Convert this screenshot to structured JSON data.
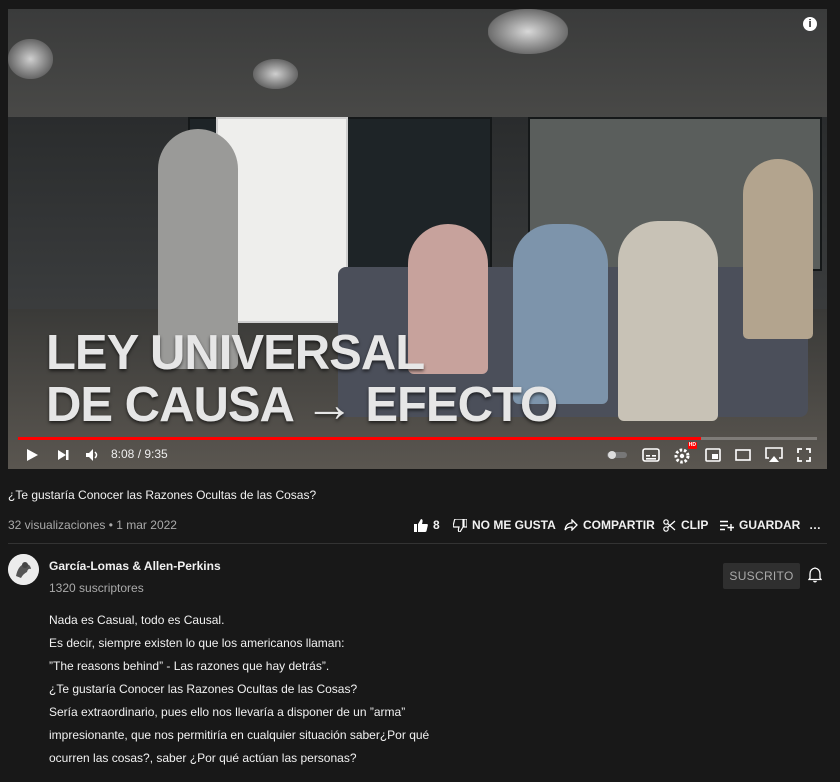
{
  "video": {
    "overlay_line1": "LEY UNIVERSAL",
    "overlay_line2": "DE CAUSA → EFECTO",
    "progress_fraction": 0.855,
    "time_display": "8:08 / 9:35"
  },
  "controls": {
    "play_icon": "play-icon",
    "next_icon": "next-icon",
    "volume_icon": "volume-icon",
    "autoplay_icon": "autoplay-toggle-icon",
    "subtitles_icon": "subtitles-icon",
    "settings_icon": "settings-icon",
    "settings_badge": "HD",
    "miniplayer_icon": "miniplayer-icon",
    "theater_icon": "theater-icon",
    "airplay_icon": "airplay-icon",
    "fullscreen_icon": "fullscreen-icon"
  },
  "title": "¿Te gustaría Conocer las Razones Ocultas de las Cosas?",
  "meta": "32 visualizaciones • 1 mar 2022",
  "actions": {
    "like_count": "8",
    "dislike_label": "NO ME GUSTA",
    "share_label": "COMPARTIR",
    "clip_label": "CLIP",
    "save_label": "GUARDAR",
    "more_label": "…"
  },
  "channel": {
    "name": "García-Lomas & Allen-Perkins",
    "subscribers": "1320 suscriptores",
    "subscribe_label": "SUSCRITO"
  },
  "description": [
    "Nada es Casual, todo es Causal.",
    "Es decir, siempre existen lo que los americanos llaman:",
    "”The reasons behind” - Las razones que hay detrás”.",
    "¿Te gustaría Conocer las Razones Ocultas de las Cosas?",
    "Sería extraordinario, pues ello nos llevaría a disponer de un ”arma”",
    "impresionante, que nos permitiría en cualquier situación saber¿Por qué",
    "ocurren las cosas?, saber ¿Por qué actúan las personas?"
  ],
  "colors": {
    "background": "#181818",
    "progress": "#ff0000",
    "text_primary": "#f1f1f1",
    "text_secondary": "#aaaaaa"
  }
}
